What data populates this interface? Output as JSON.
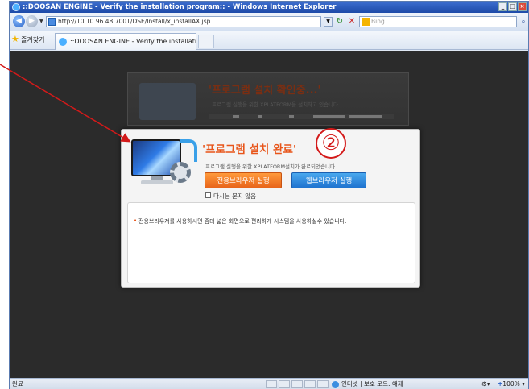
{
  "window": {
    "title": "::DOOSAN ENGINE - Verify the installation program:: - Windows Internet Explorer",
    "controls": [
      "_",
      "□",
      "×"
    ]
  },
  "toolbar": {
    "url": "http://10.10.96.48:7001/DSE/Install/x_installAX.jsp",
    "search_placeholder": "Bing",
    "favorites_label": "즐겨찾기",
    "tab_title": "::DOOSAN ENGINE - Verify the installation pr..."
  },
  "background_dialog": {
    "title": "'프로그램 설치 확인중...'",
    "subtitle": "프로그램 실행을 위한 XPLATFORM을 설치하고 있습니다."
  },
  "dialog": {
    "title": "'프로그램 설치 완료'",
    "subtitle": "프로그램 실행을 위한 XPLATFORM설치가 완료되었습니다.",
    "primary_button": "전용브라우저 실행",
    "secondary_button": "웹브라우저 실행",
    "checkbox_label": "다시는 묻지 않음",
    "note": "전용브라우저를 사용하시면 좀더 넓은 화면으로 편리하게 시스템을 사용하실수 있습니다."
  },
  "annotation": {
    "marker": "②",
    "color": "#d31a1a"
  },
  "statusbar": {
    "left": "완료",
    "zone": "인터넷 | 보호 모드: 해제",
    "zoom": "100%"
  },
  "colors": {
    "title_orange": "#e8551a",
    "primary_btn": "#ff7a22",
    "secondary_btn": "#2a86dc",
    "page_bg": "#2b2b2b"
  },
  "icons": [
    "ie-icon",
    "back-icon",
    "forward-icon",
    "page-icon",
    "refresh-icon",
    "stop-icon",
    "bing-icon",
    "search-icon",
    "favorites-star-icon",
    "monitor-icon",
    "gear-icon",
    "globe-icon"
  ]
}
